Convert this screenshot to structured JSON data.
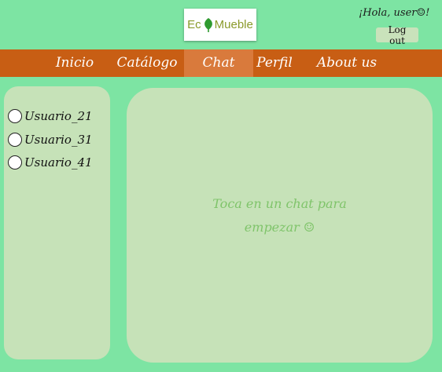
{
  "header": {
    "logo_text_left": "Ec",
    "logo_text_right": "Mueble",
    "greeting": "¡Hola, user☺!",
    "logout_label": "Log out"
  },
  "nav": {
    "items": [
      {
        "label": "Inicio"
      },
      {
        "label": "Catálogo"
      },
      {
        "label": "Chat"
      },
      {
        "label": "Perfil"
      },
      {
        "label": "About us"
      }
    ],
    "active": "Chat"
  },
  "users": [
    {
      "label": "Usuario_21"
    },
    {
      "label": "Usuario_31"
    },
    {
      "label": "Usuario_41"
    }
  ],
  "chat": {
    "empty_line1": "Toca en un chat para",
    "empty_line2": "empezar ☺"
  },
  "colors": {
    "background": "#7de4a3",
    "nav": "#c85e14",
    "nav_active": "#d97a3c",
    "panel": "#c6e2b8",
    "hint_text": "#7fc46a"
  }
}
